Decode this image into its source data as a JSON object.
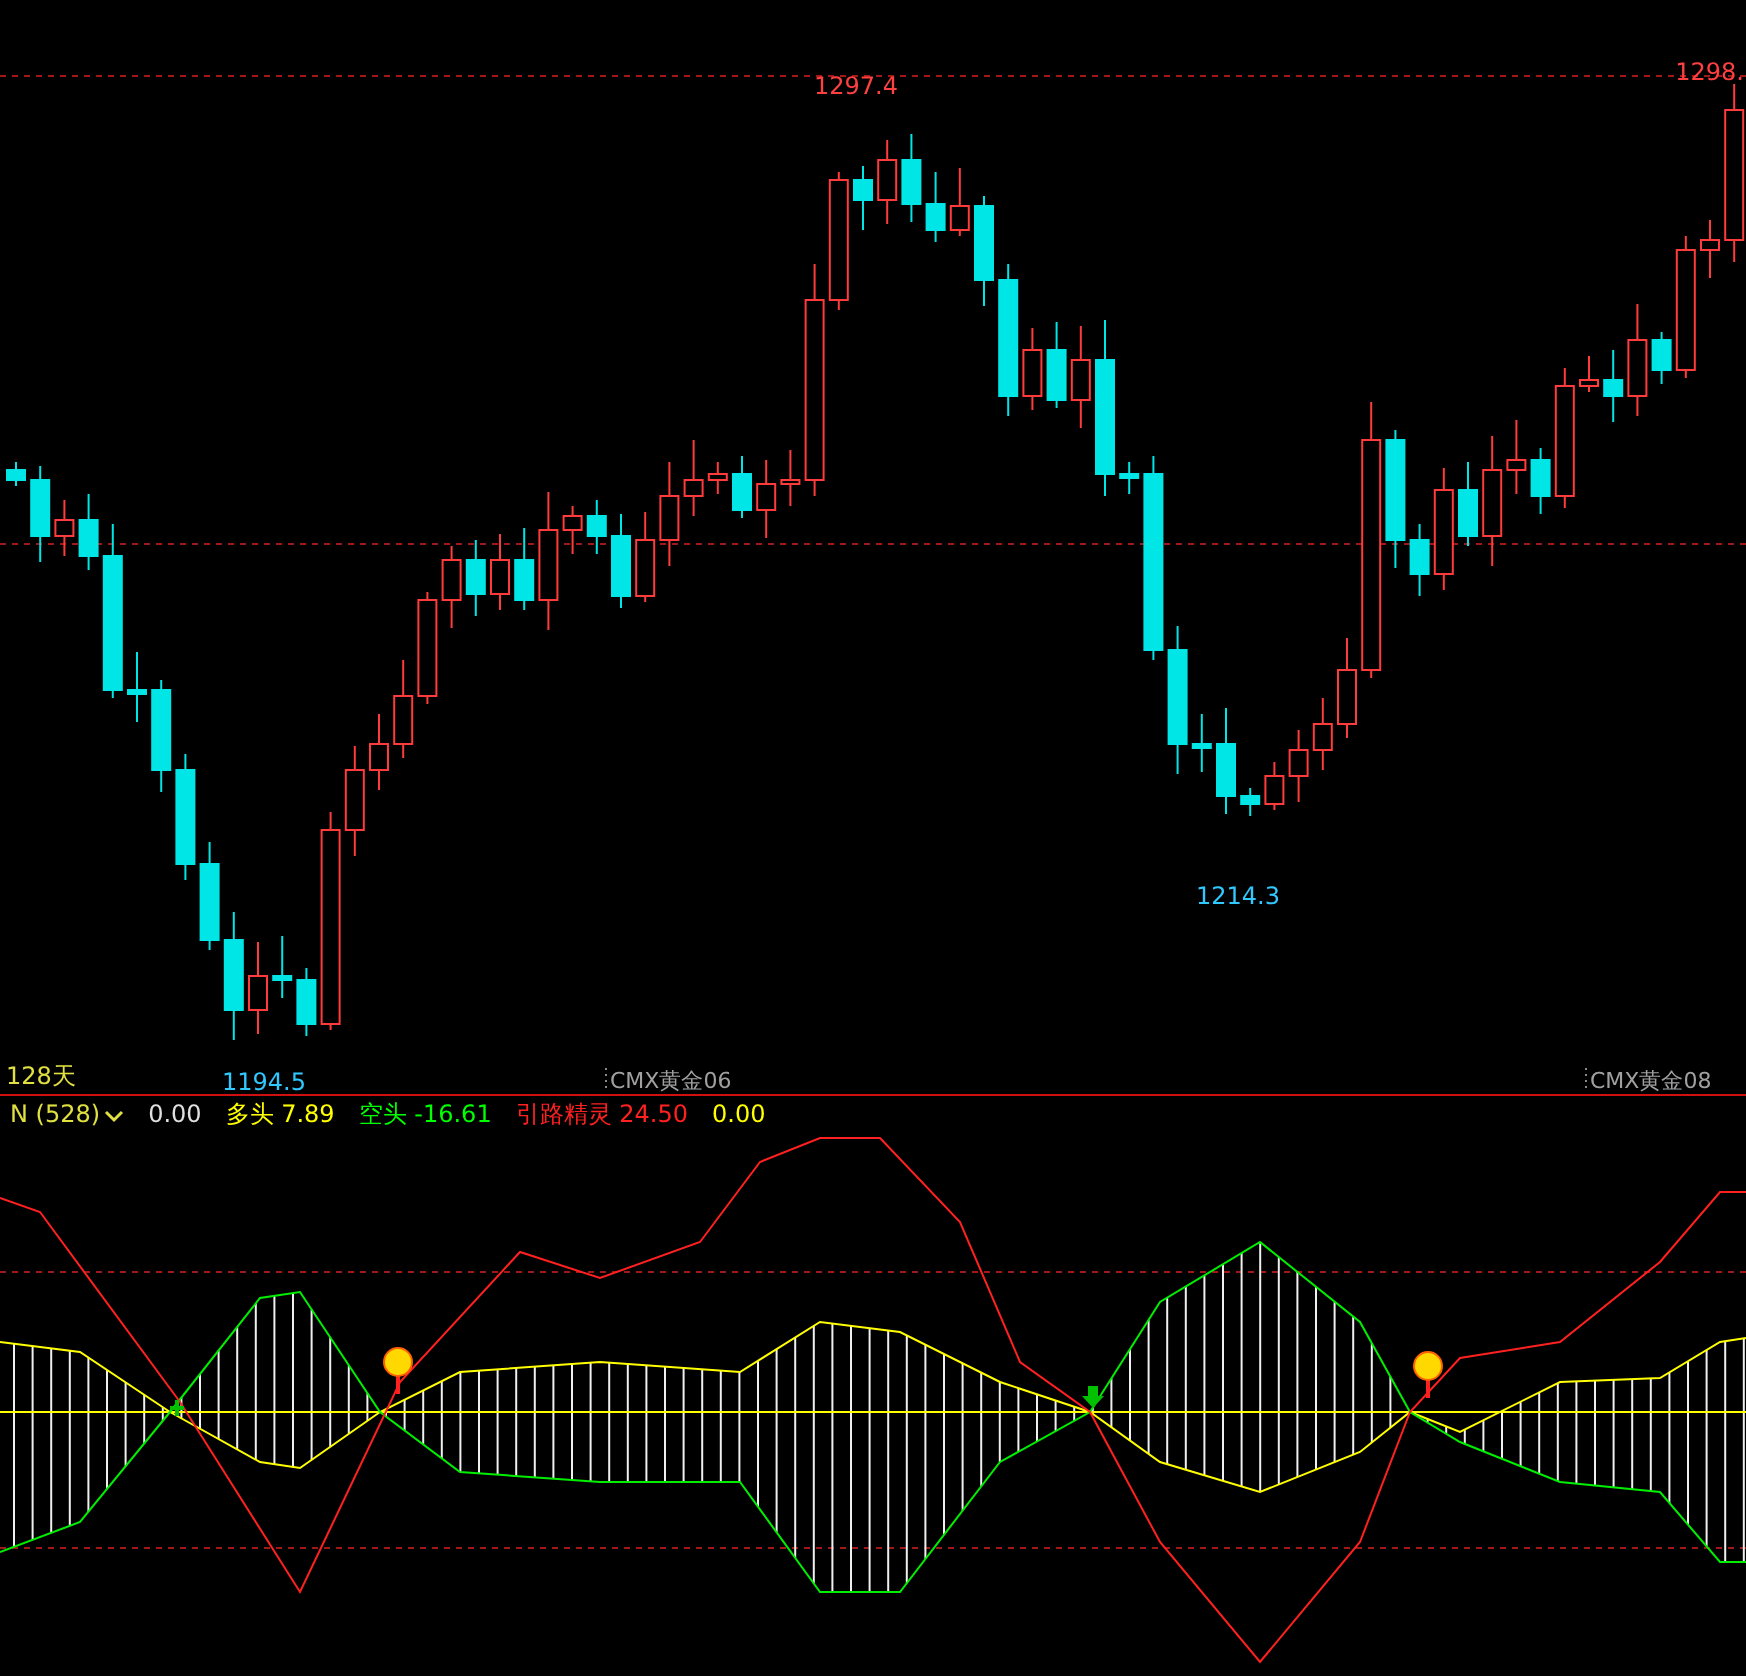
{
  "price_chart": {
    "price_labels": [
      {
        "text": "1297.4",
        "kind": "high"
      },
      {
        "text": "1298.",
        "kind": "high"
      },
      {
        "text": "1214.3",
        "kind": "low"
      },
      {
        "text": "1194.5",
        "kind": "low"
      }
    ],
    "period": "128天",
    "contracts": [
      "CMX黄金06",
      "CMX黄金08"
    ]
  },
  "indicator": {
    "name": "N (528)",
    "readings": [
      {
        "value": "0.00",
        "color": "#e0e0e0"
      },
      {
        "label": "多头",
        "value": "7.89",
        "color": "#ffff00"
      },
      {
        "label": "空头",
        "value": "-16.61",
        "color": "#00ff00"
      },
      {
        "label": "引路精灵",
        "value": "24.50",
        "color": "#ff2020"
      },
      {
        "value": "0.00",
        "color": "#ffff00"
      }
    ]
  }
}
